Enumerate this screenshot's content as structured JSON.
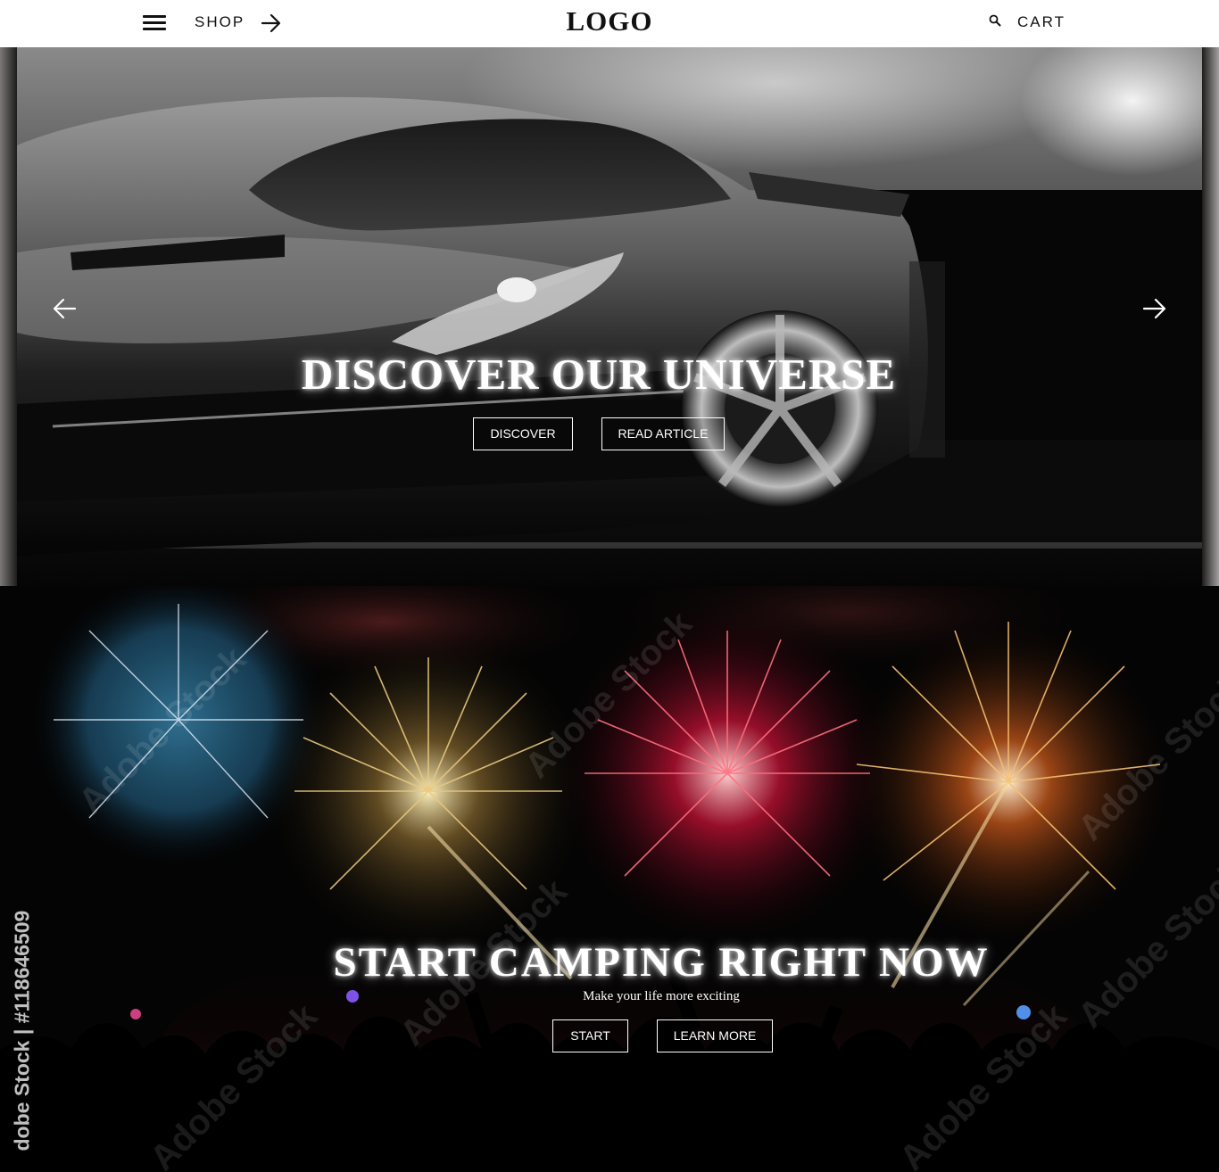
{
  "header": {
    "menu_icon": "hamburger-menu-icon",
    "shop_label": "SHOP",
    "shop_arrow_icon": "arrow-right-icon",
    "logo": "LOGO",
    "search_icon": "search-icon",
    "cart_label": "CART"
  },
  "hero1": {
    "title": "DISCOVER OUR UNIVERSE",
    "prev_icon": "arrow-left-icon",
    "next_icon": "arrow-right-icon",
    "buttons": [
      "DISCOVER",
      "READ ARTICLE"
    ]
  },
  "hero2": {
    "title": "START CAMPING RIGHT NOW",
    "subtitle": "Make your life more exciting",
    "buttons": [
      "START",
      "LEARN MORE"
    ],
    "watermark_text": "Adobe Stock",
    "side_watermark": "dobe Stock | #118646509"
  }
}
